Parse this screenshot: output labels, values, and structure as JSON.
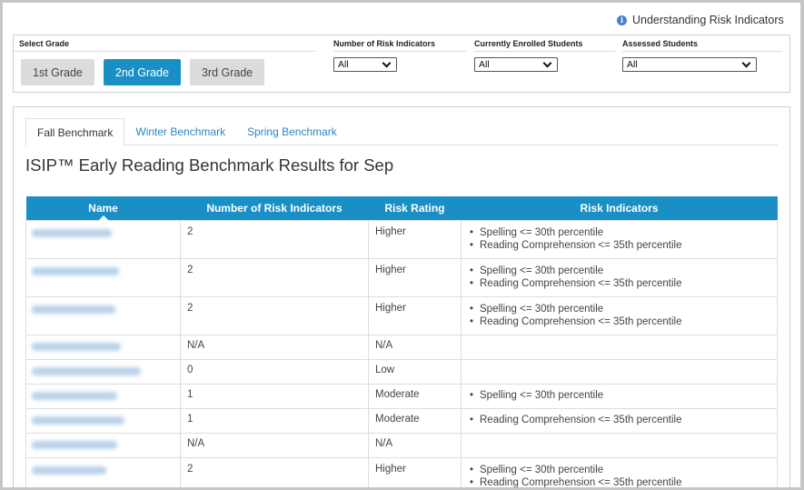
{
  "help": {
    "label": "Understanding Risk Indicators",
    "icon": "info-icon"
  },
  "filters": {
    "grade": {
      "label": "Select Grade",
      "options": [
        "1st Grade",
        "2nd Grade",
        "3rd Grade"
      ],
      "selected": "2nd Grade"
    },
    "risk_indicators": {
      "label": "Number of Risk Indicators",
      "value": "All"
    },
    "enrolled": {
      "label": "Currently Enrolled Students",
      "value": "All"
    },
    "assessed": {
      "label": "Assessed Students",
      "value": "All"
    }
  },
  "tabs": [
    {
      "label": "Fall Benchmark",
      "active": true
    },
    {
      "label": "Winter Benchmark",
      "active": false
    },
    {
      "label": "Spring Benchmark",
      "active": false
    }
  ],
  "results_title": "ISIP™ Early Reading Benchmark Results for Sep",
  "table": {
    "headers": [
      "Name",
      "Number of Risk Indicators",
      "Risk Rating",
      "Risk Indicators"
    ],
    "rows": [
      {
        "count": "2",
        "rating": "Higher",
        "indicators": [
          "Spelling <= 30th percentile",
          "Reading Comprehension <= 35th percentile"
        ]
      },
      {
        "count": "2",
        "rating": "Higher",
        "indicators": [
          "Spelling <= 30th percentile",
          "Reading Comprehension <= 35th percentile"
        ]
      },
      {
        "count": "2",
        "rating": "Higher",
        "indicators": [
          "Spelling <= 30th percentile",
          "Reading Comprehension <= 35th percentile"
        ]
      },
      {
        "count": "N/A",
        "rating": "N/A",
        "indicators": []
      },
      {
        "count": "0",
        "rating": "Low",
        "indicators": []
      },
      {
        "count": "1",
        "rating": "Moderate",
        "indicators": [
          "Spelling <= 30th percentile"
        ]
      },
      {
        "count": "1",
        "rating": "Moderate",
        "indicators": [
          "Reading Comprehension <= 35th percentile"
        ]
      },
      {
        "count": "N/A",
        "rating": "N/A",
        "indicators": []
      },
      {
        "count": "2",
        "rating": "Higher",
        "indicators": [
          "Spelling <= 30th percentile",
          "Reading Comprehension <= 35th percentile"
        ]
      }
    ]
  }
}
